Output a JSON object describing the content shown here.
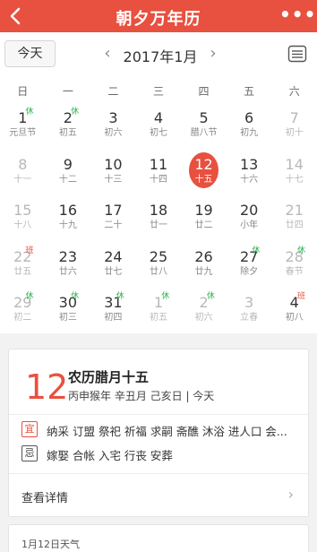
{
  "app": {
    "title": "朝夕万年历",
    "more_label": "•••"
  },
  "toolbar": {
    "today_label": "今天",
    "month_label": "2017年1月",
    "prev_label": "‹",
    "next_label": "›"
  },
  "weekdays": [
    "日",
    "一",
    "二",
    "三",
    "四",
    "五",
    "六"
  ],
  "weeks": [
    [
      {
        "d": "1",
        "l": "元旦节",
        "t": "休"
      },
      {
        "d": "2",
        "l": "初五",
        "t": "休"
      },
      {
        "d": "3",
        "l": "初六"
      },
      {
        "d": "4",
        "l": "初七"
      },
      {
        "d": "5",
        "l": "腊八节"
      },
      {
        "d": "6",
        "l": "初九"
      },
      {
        "d": "7",
        "l": "初十",
        "dim": true
      }
    ],
    [
      {
        "d": "8",
        "l": "十一",
        "dim": true
      },
      {
        "d": "9",
        "l": "十二"
      },
      {
        "d": "10",
        "l": "十三"
      },
      {
        "d": "11",
        "l": "十四"
      },
      {
        "d": "12",
        "l": "十五",
        "today": true
      },
      {
        "d": "13",
        "l": "十六"
      },
      {
        "d": "14",
        "l": "十七",
        "dim": true
      }
    ],
    [
      {
        "d": "15",
        "l": "十八",
        "dim": true
      },
      {
        "d": "16",
        "l": "十九"
      },
      {
        "d": "17",
        "l": "二十"
      },
      {
        "d": "18",
        "l": "廿一"
      },
      {
        "d": "19",
        "l": "廿二"
      },
      {
        "d": "20",
        "l": "小年"
      },
      {
        "d": "21",
        "l": "廿四",
        "dim": true
      }
    ],
    [
      {
        "d": "22",
        "l": "廿五",
        "dim": true,
        "t": "班"
      },
      {
        "d": "23",
        "l": "廿六"
      },
      {
        "d": "24",
        "l": "廿七"
      },
      {
        "d": "25",
        "l": "廿八"
      },
      {
        "d": "26",
        "l": "廿九"
      },
      {
        "d": "27",
        "l": "除夕",
        "t": "休"
      },
      {
        "d": "28",
        "l": "春节",
        "dim": true,
        "t": "休"
      }
    ],
    [
      {
        "d": "29",
        "l": "初二",
        "dim": true,
        "t": "休"
      },
      {
        "d": "30",
        "l": "初三",
        "t": "休"
      },
      {
        "d": "31",
        "l": "初四",
        "t": "休"
      },
      {
        "d": "1",
        "l": "初五",
        "dim": true,
        "t": "休"
      },
      {
        "d": "2",
        "l": "初六",
        "dim": true,
        "t": "休"
      },
      {
        "d": "3",
        "l": "立春",
        "dim": true
      },
      {
        "d": "4",
        "l": "初八",
        "t": "班"
      }
    ]
  ],
  "detail": {
    "day": "12",
    "lunar_title": "农历腊月十五",
    "ganzhi": "丙申猴年 辛丑月 己亥日 | 今天",
    "yi_label": "宜",
    "yi_text": "纳采 订盟 祭祀 祈福 求嗣 斋醮 沐浴 进人口 会...",
    "ji_label": "忌",
    "ji_text": "嫁娶 合帐 入宅 行丧 安葬",
    "view_details": "查看详情",
    "arrow": "›"
  },
  "weather": {
    "title": "1月12日天气"
  },
  "colors": {
    "accent": "#e8503f",
    "holiday_green": "#2bb24c"
  }
}
